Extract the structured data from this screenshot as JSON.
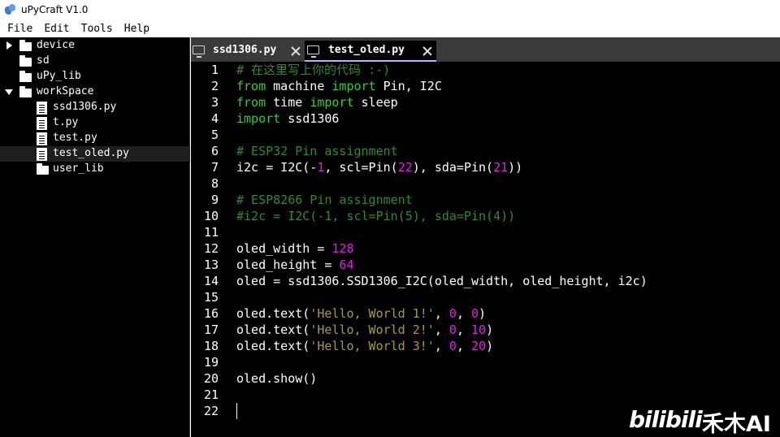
{
  "window": {
    "title": "uPyCraft V1.0"
  },
  "menu": [
    "File",
    "Edit",
    "Tools",
    "Help"
  ],
  "tree": [
    {
      "label": "device",
      "kind": "folder",
      "expanded": false
    },
    {
      "label": "sd",
      "kind": "folder",
      "expanded": null
    },
    {
      "label": "uPy_lib",
      "kind": "folder",
      "expanded": null
    },
    {
      "label": "workSpace",
      "kind": "folder",
      "expanded": true
    },
    {
      "label": "ssd1306.py",
      "kind": "file"
    },
    {
      "label": "t.py",
      "kind": "file"
    },
    {
      "label": "test.py",
      "kind": "file"
    },
    {
      "label": "test_oled.py",
      "kind": "file",
      "selected": true
    },
    {
      "label": "user_lib",
      "kind": "folder"
    }
  ],
  "tabs": [
    {
      "label": "ssd1306.py",
      "active": false
    },
    {
      "label": "test_oled.py",
      "active": true
    }
  ],
  "editor": {
    "line_numbers": [
      "1",
      "2",
      "3",
      "4",
      "5",
      "6",
      "7",
      "8",
      "9",
      "10",
      "11",
      "12",
      "13",
      "14",
      "15",
      "16",
      "17",
      "18",
      "19",
      "20",
      "21",
      "22"
    ],
    "lines": [
      [
        [
          "cm",
          "# 在这里写上你的代码 :-)"
        ]
      ],
      [
        [
          "kw",
          "from"
        ],
        [
          "tx",
          " machine "
        ],
        [
          "kw",
          "import"
        ],
        [
          "tx",
          " Pin, I2C"
        ]
      ],
      [
        [
          "kw",
          "from"
        ],
        [
          "tx",
          " time "
        ],
        [
          "kw",
          "import"
        ],
        [
          "tx",
          " sleep"
        ]
      ],
      [
        [
          "kw",
          "import"
        ],
        [
          "tx",
          " ssd1306"
        ]
      ],
      [],
      [
        [
          "cm",
          "# ESP32 Pin assignment"
        ]
      ],
      [
        [
          "tx",
          "i2c = I2C(-"
        ],
        [
          "num",
          "1"
        ],
        [
          "tx",
          ", scl=Pin("
        ],
        [
          "num",
          "22"
        ],
        [
          "tx",
          "), sda=Pin("
        ],
        [
          "num",
          "21"
        ],
        [
          "tx",
          "))"
        ]
      ],
      [],
      [
        [
          "cm",
          "# ESP8266 Pin assignment"
        ]
      ],
      [
        [
          "cm",
          "#i2c = I2C(-1, scl=Pin(5), sda=Pin(4))"
        ]
      ],
      [],
      [
        [
          "tx",
          "oled_width = "
        ],
        [
          "num",
          "128"
        ]
      ],
      [
        [
          "tx",
          "oled_height = "
        ],
        [
          "num",
          "64"
        ]
      ],
      [
        [
          "tx",
          "oled = ssd1306.SSD1306_I2C(oled_width, oled_height, i2c)"
        ]
      ],
      [],
      [
        [
          "tx",
          "oled.text("
        ],
        [
          "str",
          "'Hello, World 1!'"
        ],
        [
          "tx",
          ", "
        ],
        [
          "num",
          "0"
        ],
        [
          "tx",
          ", "
        ],
        [
          "num",
          "0"
        ],
        [
          "tx",
          ")"
        ]
      ],
      [
        [
          "tx",
          "oled.text("
        ],
        [
          "str",
          "'Hello, World 2!'"
        ],
        [
          "tx",
          ", "
        ],
        [
          "num",
          "0"
        ],
        [
          "tx",
          ", "
        ],
        [
          "num",
          "10"
        ],
        [
          "tx",
          ")"
        ]
      ],
      [
        [
          "tx",
          "oled.text("
        ],
        [
          "str",
          "'Hello, World 3!'"
        ],
        [
          "tx",
          ", "
        ],
        [
          "num",
          "0"
        ],
        [
          "tx",
          ", "
        ],
        [
          "num",
          "20"
        ],
        [
          "tx",
          ")"
        ]
      ],
      [],
      [
        [
          "tx",
          "oled.show()"
        ]
      ],
      [],
      []
    ]
  },
  "watermark": {
    "logo": "bilibili",
    "text": "禾木AI"
  },
  "colors": {
    "keyword": "#27d427",
    "comment": "#2e8b2e",
    "number": "#e020e0",
    "string": "#a89a3a",
    "background": "#000000"
  }
}
